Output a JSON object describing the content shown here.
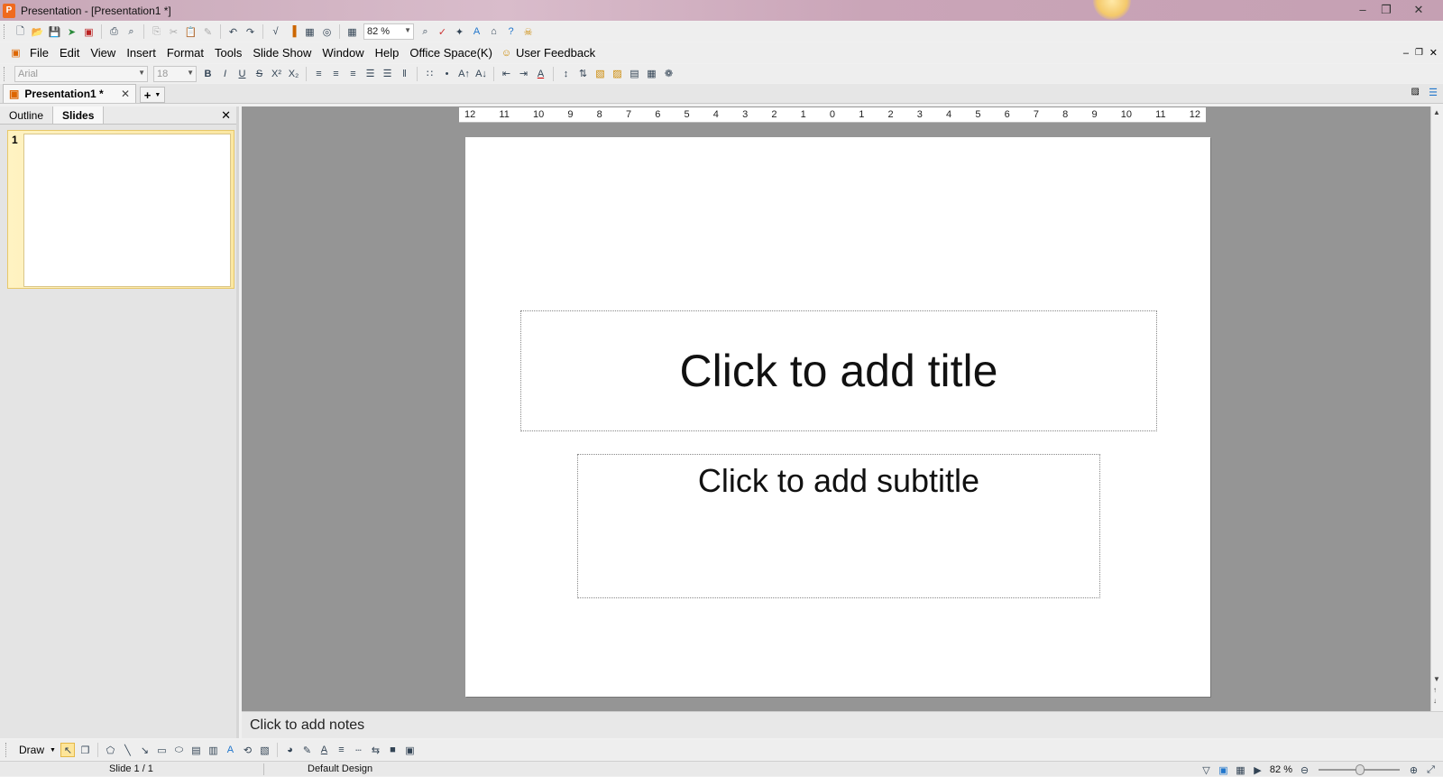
{
  "window": {
    "title": "Presentation - [Presentation1 *]",
    "app_icon_letter": "P"
  },
  "toolbar": {
    "zoom_value": "82 %"
  },
  "menu": {
    "items": [
      "File",
      "Edit",
      "View",
      "Insert",
      "Format",
      "Tools",
      "Slide Show",
      "Window",
      "Help",
      "Office Space(K)",
      "User Feedback"
    ]
  },
  "format_bar": {
    "font": "Arial",
    "size": "18"
  },
  "doc_tab": {
    "label": "Presentation1 *"
  },
  "left_pane": {
    "tabs": [
      "Outline",
      "Slides"
    ],
    "active_tab": "Slides",
    "slide_number": "1"
  },
  "ruler": {
    "labels": [
      "12",
      "11",
      "10",
      "9",
      "8",
      "7",
      "6",
      "5",
      "4",
      "3",
      "2",
      "1",
      "0",
      "1",
      "2",
      "3",
      "4",
      "5",
      "6",
      "7",
      "8",
      "9",
      "10",
      "11",
      "12"
    ]
  },
  "slide": {
    "title_placeholder": "Click to add title",
    "subtitle_placeholder": "Click to add subtitle"
  },
  "notes": {
    "placeholder": "Click to add notes"
  },
  "drawbar": {
    "draw_label": "Draw"
  },
  "status": {
    "slide_info": "Slide 1 / 1",
    "design": "Default Design",
    "zoom": "82 %"
  },
  "colors": {
    "titlebar": "#c7a7b7",
    "workspace": "#959595",
    "selection": "#fbe7a2"
  }
}
